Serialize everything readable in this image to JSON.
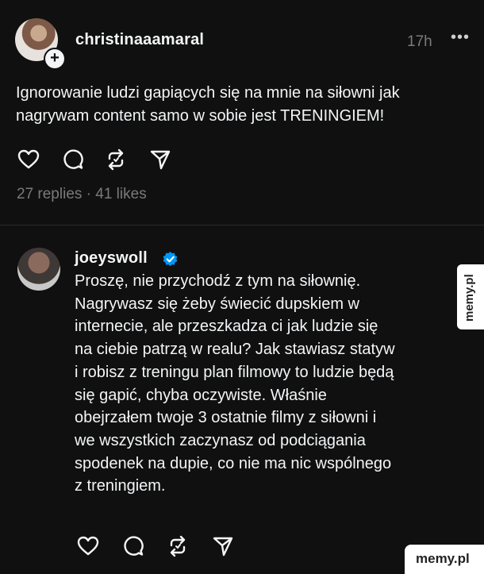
{
  "posts": [
    {
      "username": "christinaaamaral",
      "time": "17h",
      "more": "•••",
      "follow_symbol": "+",
      "text": "Ignorowanie ludzi gapiących się na mnie na siłowni jak\nnagrywam content samo w sobie jest TRENINGIEM!",
      "stats": "27 replies · 41 likes"
    },
    {
      "username": "joeyswoll",
      "verified": true,
      "text": "Proszę, nie przychodź z tym na siłownię.\nNagrywasz się żeby świecić dupskiem w\ninternecie, ale przeszkadza ci jak ludzie się\nna ciebie patrzą w realu? Jak stawiasz statyw\ni robisz z treningu plan filmowy to ludzie będą\nsię gapić, chyba oczywiste. Właśnie\nobejrzałem twoje 3 ostatnie filmy z siłowni i\nwe wszystkich zaczynasz od podciągania\nspodenek na dupie, co nie ma nic wspólnego\nz treningiem."
    }
  ],
  "actions": [
    "heart-icon",
    "comment-icon",
    "repost-icon",
    "share-icon"
  ],
  "watermarks": {
    "side": "memy.pl",
    "corner": "memy.pl"
  },
  "colors": {
    "background": "#101010",
    "text": "#f3f5f7",
    "muted": "#7a7a7a",
    "verified": "#0095f6"
  }
}
